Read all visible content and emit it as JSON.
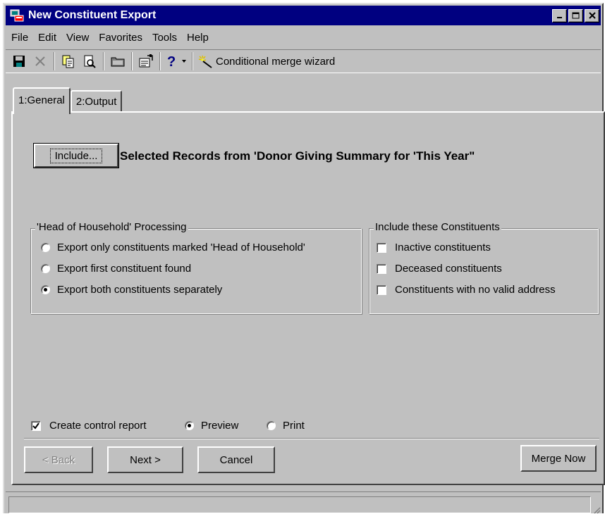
{
  "window": {
    "title": "New Constituent Export",
    "icon": "app-export-icon"
  },
  "menu": [
    {
      "label": "File"
    },
    {
      "label": "Edit"
    },
    {
      "label": "View"
    },
    {
      "label": "Favorites"
    },
    {
      "label": "Tools"
    },
    {
      "label": "Help"
    }
  ],
  "toolbar": {
    "icons": [
      "save-icon",
      "delete-icon",
      "copy-icon",
      "print-preview-icon",
      "folder-icon",
      "properties-icon",
      "help-icon",
      "dropdown-icon",
      "wizard-wand-icon"
    ],
    "wizard_label": "Conditional merge wizard"
  },
  "tabs": [
    {
      "label": "1:General",
      "active": true
    },
    {
      "label": "2:Output",
      "active": false
    }
  ],
  "include": {
    "button_label": "Include...",
    "selected_text": "Selected Records from 'Donor Giving Summary for 'This Year\""
  },
  "hoh_group": {
    "legend": "'Head of Household' Processing",
    "options": [
      {
        "label": "Export only constituents marked 'Head of Household'",
        "selected": false
      },
      {
        "label": "Export first constituent found",
        "selected": false
      },
      {
        "label": "Export both constituents separately",
        "selected": true
      }
    ]
  },
  "include_group": {
    "legend": "Include these Constituents",
    "options": [
      {
        "label": "Inactive constituents",
        "checked": false
      },
      {
        "label": "Deceased constituents",
        "checked": false
      },
      {
        "label": "Constituents with no valid address",
        "checked": false
      }
    ]
  },
  "report": {
    "create_label": "Create control report",
    "create_checked": true,
    "preview_label": "Preview",
    "preview_selected": true,
    "print_label": "Print",
    "print_selected": false
  },
  "footer": {
    "back_label": "< Back",
    "next_label": "Next >",
    "cancel_label": "Cancel",
    "merge_now_label": "Merge Now"
  },
  "colors": {
    "titlebar": "#000080",
    "face": "#c0c0c0"
  }
}
